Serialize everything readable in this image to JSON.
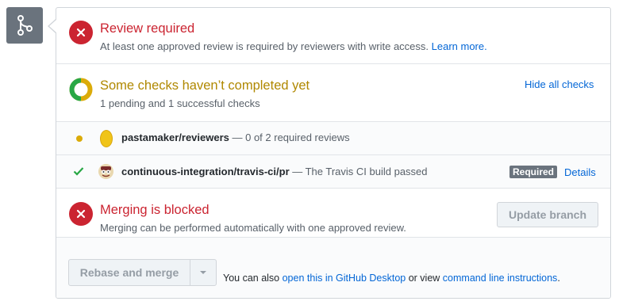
{
  "review": {
    "title": "Review required",
    "subtitle": "At least one approved review is required by reviewers with write access.",
    "learn_more": "Learn more."
  },
  "checks": {
    "title": "Some checks haven’t completed yet",
    "subtitle": "1 pending and 1 successful checks",
    "hide_link": "Hide all checks",
    "items": [
      {
        "status": "pending",
        "name": "pastamaker/reviewers",
        "description": " — 0 of 2 required reviews"
      },
      {
        "status": "success",
        "name": "continuous-integration/travis-ci/pr",
        "description": " — The Travis CI build passed",
        "badge": "Required",
        "details": "Details"
      }
    ]
  },
  "merge": {
    "title": "Merging is blocked",
    "subtitle": "Merging can be performed automatically with one approved review.",
    "update_branch": "Update branch"
  },
  "footer": {
    "rebase_button": "Rebase and merge",
    "also_prefix": "You can also ",
    "desktop_link": "open this in GitHub Desktop",
    "or_view": " or view ",
    "cli_link": "command line instructions",
    "suffix": "."
  },
  "colors": {
    "error": "#cb2431",
    "pending": "#dbab09",
    "success": "#28a745",
    "link": "#0366d6",
    "badge": "#6a737d"
  },
  "icons": {
    "badge": "git-merge-icon",
    "review_status": "x-circle-icon",
    "checks_status": "progress-ring-icon",
    "check_pending": "dot-icon",
    "check_success": "checkmark-icon",
    "merge_status": "x-circle-icon",
    "dropdown": "caret-down-icon"
  }
}
